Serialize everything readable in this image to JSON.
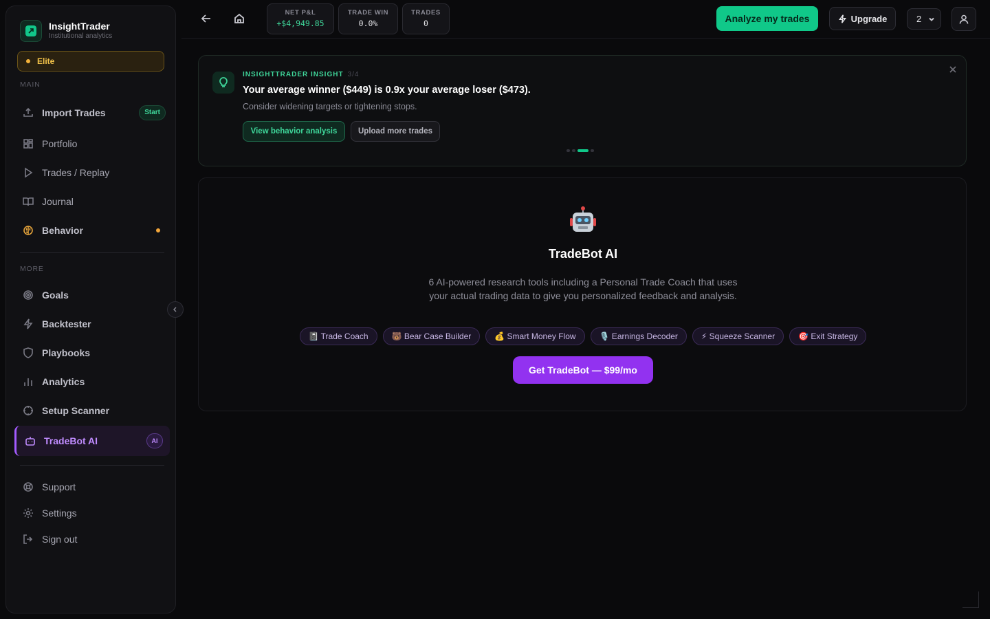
{
  "brand": {
    "name": "InsightTrader",
    "tagline": "Institutional analytics"
  },
  "plan_badge": "Elite",
  "sidebar": {
    "main_label": "MAIN",
    "more_label": "MORE",
    "main_items": [
      {
        "label": "Import Trades",
        "badge": "Start"
      },
      {
        "label": "Portfolio"
      },
      {
        "label": "Trades / Replay"
      },
      {
        "label": "Journal"
      },
      {
        "label": "Behavior"
      }
    ],
    "more_items": [
      {
        "label": "Goals"
      },
      {
        "label": "Backtester"
      },
      {
        "label": "Playbooks"
      },
      {
        "label": "Analytics"
      },
      {
        "label": "Setup Scanner"
      },
      {
        "label": "TradeBot AI",
        "badge": "AI",
        "active": true
      }
    ],
    "footer_items": [
      {
        "label": "Support"
      },
      {
        "label": "Settings"
      },
      {
        "label": "Sign out"
      }
    ]
  },
  "topbar": {
    "stats": [
      {
        "label": "NET P&L",
        "value": "+$4,949.85"
      },
      {
        "label": "TRADE WIN",
        "value": "0.0%"
      },
      {
        "label": "TRADES",
        "value": "0"
      }
    ],
    "analyze_label": "Analyze my trades",
    "upgrade_label": "Upgrade",
    "select_value": "2"
  },
  "insight": {
    "kicker": "INSIGHTTRADER INSIGHT",
    "counter": "3/4",
    "title": "Your average winner ($449) is 0.9x your average loser ($473).",
    "subtitle": "Consider widening targets or tightening stops.",
    "primary_action": "View behavior analysis",
    "secondary_action": "Upload more trades",
    "current_page": 3,
    "total_pages": 4
  },
  "tradebot": {
    "emoji": "🤖",
    "title": "TradeBot AI",
    "description": "6 AI-powered research tools including a Personal Trade Coach that uses your actual trading data to give you personalized feedback and analysis.",
    "tools": [
      "📓 Trade Coach",
      "🐻 Bear Case Builder",
      "💰 Smart Money Flow",
      "🎙️ Earnings Decoder",
      "⚡ Squeeze Scanner",
      "🎯 Exit Strategy"
    ],
    "cta": "Get TradeBot — $99/mo"
  },
  "colors": {
    "accent_green": "#10c889",
    "accent_purple": "#9232f0",
    "gold": "#f3c34a"
  }
}
